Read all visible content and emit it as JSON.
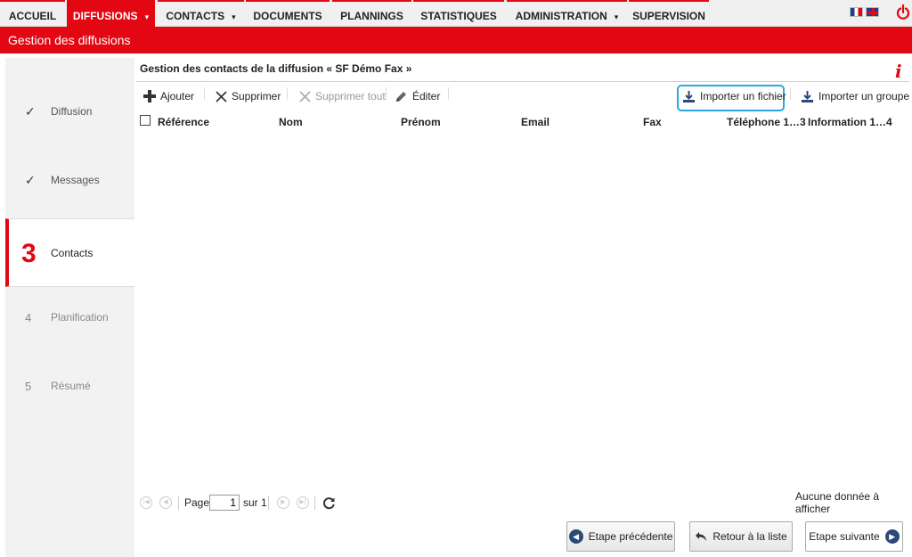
{
  "nav": {
    "items": [
      {
        "label": "ACCUEIL"
      },
      {
        "label": "DIFFUSIONS",
        "active": true
      },
      {
        "label": "CONTACTS"
      },
      {
        "label": "DOCUMENTS"
      },
      {
        "label": "PLANNINGS"
      },
      {
        "label": "STATISTIQUES"
      },
      {
        "label": "ADMINISTRATION"
      },
      {
        "label": "SUPERVISION"
      }
    ],
    "caret": "▾",
    "languages": [
      "fr-flag-icon",
      "uk-flag-icon"
    ],
    "logout_icon": "power-icon"
  },
  "titlebar": {
    "title": "Gestion des diffusions"
  },
  "steps": [
    {
      "mark": "✓",
      "label": "Diffusion",
      "state": "done"
    },
    {
      "mark": "✓",
      "label": "Messages",
      "state": "done"
    },
    {
      "mark": "3",
      "label": "Contacts",
      "state": "active"
    },
    {
      "mark": "4",
      "label": "Planification",
      "state": "todo"
    },
    {
      "mark": "5",
      "label": "Résumé",
      "state": "todo"
    }
  ],
  "panel": {
    "title": "Gestion des contacts de la diffusion « SF Démo Fax »",
    "info_icon": "i"
  },
  "toolbar": {
    "add": "Ajouter",
    "delete": "Supprimer",
    "delete_all": "Supprimer tout",
    "edit": "Éditer",
    "import_file": "Importer un fichier",
    "import_group": "Importer un groupe"
  },
  "table": {
    "columns": [
      "Référence",
      "Nom",
      "Prénom",
      "Email",
      "Fax",
      "Téléphone 1…3",
      "Information 1…4"
    ],
    "rows": []
  },
  "pager": {
    "page_label": "Page",
    "page_value": "1",
    "of_label": "sur 1",
    "empty_text": "Aucune donnée à afficher"
  },
  "buttons": {
    "previous": "Etape précédente",
    "back": "Retour à la liste",
    "next": "Etape suivante"
  },
  "colors": {
    "accent": "#e30613",
    "highlight": "#2aa8e0",
    "button_icon": "#2b4a77"
  }
}
